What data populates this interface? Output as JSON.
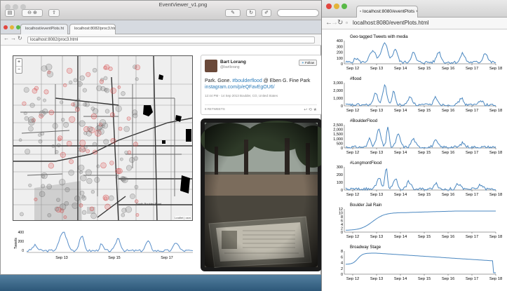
{
  "viewer": {
    "title": "EventViewer_v1.png"
  },
  "browser_left": {
    "tabs": [
      "localhost/eventPlots.ht",
      "localhost:8082/proc3.html"
    ],
    "url": "localhost:8082/proc3.html"
  },
  "map": {
    "zoom_in": "+",
    "zoom_out": "−",
    "attribution": "Leaflet | osm"
  },
  "mini_chart": {
    "ylabel": "Tweets",
    "yticks": [
      "400",
      "200",
      "0"
    ],
    "xticks": [
      "Sep 13",
      "Sep 15",
      "Sep 17"
    ]
  },
  "tweet": {
    "name": "Bart Lorang",
    "handle": "@bartlorang",
    "follow": "Follow",
    "text_a": "Park. Gone. ",
    "hashtag": "#boulderflood",
    "text_b": " @ Eben G. Fine Park",
    "link": "instagram.com/p/eQFavEgOU6/",
    "meta": "12:44 PM - 14 Sep 2013  Boulder, CO, United States",
    "retweets": "8 RETWEETS"
  },
  "browser_right": {
    "tab": "localhost:8080/eventPlots",
    "url": "localhost:8080/eventPlots.html"
  },
  "plots": [
    {
      "title": "Geo-tagged Tweets with media",
      "yticks": [
        "400",
        "300",
        "200",
        "100",
        "0"
      ]
    },
    {
      "title": "#flood",
      "yticks": [
        "3,000",
        "2,000",
        "1,000",
        "0"
      ]
    },
    {
      "title": "#BoulderFlood",
      "yticks": [
        "2,500",
        "2,000",
        "1,500",
        "1,000",
        "500",
        "0"
      ]
    },
    {
      "title": "#LongmontFlood",
      "yticks": [
        "300",
        "200",
        "100",
        "0"
      ]
    },
    {
      "title": "Boulder Jail Rain",
      "yticks": [
        "12",
        "10",
        "8",
        "6",
        "4",
        "2",
        "0"
      ]
    },
    {
      "title": "Broadway Stage",
      "yticks": [
        "8",
        "6",
        "4",
        "2",
        "0"
      ]
    }
  ],
  "xticks": [
    "Sep 12",
    "Sep 13",
    "Sep 14",
    "Sep 15",
    "Sep 16",
    "Sep 17",
    "Sep 18"
  ],
  "colors": {
    "line": "#4a87c0",
    "mini_line": "#5a8fc9"
  }
}
